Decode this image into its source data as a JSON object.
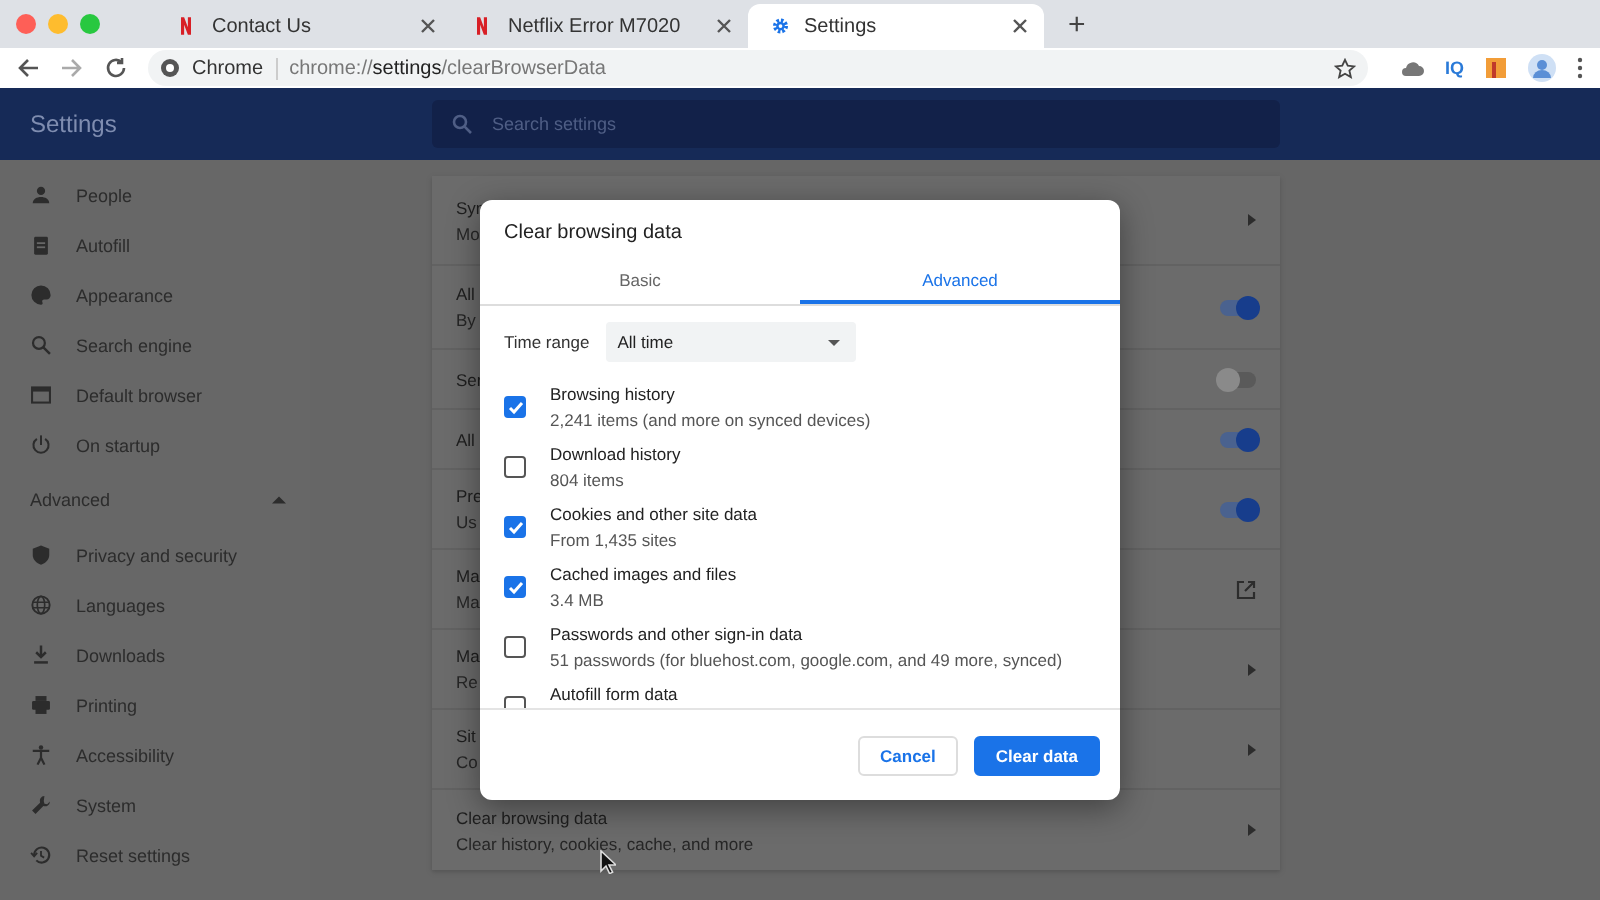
{
  "browser": {
    "tabs": [
      {
        "title": "Contact Us",
        "selected": false
      },
      {
        "title": "Netflix Error M7020",
        "selected": false
      },
      {
        "title": "Settings",
        "selected": true
      }
    ],
    "new_tab": "+",
    "address": {
      "site_label": "Chrome",
      "url": "chrome://**settings**/clearBrowserData"
    },
    "extension_label": "IQ"
  },
  "header": {
    "title": "Settings",
    "search": {
      "placeholder": "Search settings"
    }
  },
  "sidebar": {
    "items": [
      {
        "label": "People"
      },
      {
        "label": "Autofill"
      },
      {
        "label": "Appearance"
      },
      {
        "label": "Search engine"
      },
      {
        "label": "Default browser"
      },
      {
        "label": "On startup"
      }
    ],
    "advanced": {
      "label": "Advanced",
      "expanded": true,
      "items": [
        {
          "label": "Privacy and security"
        },
        {
          "label": "Languages"
        },
        {
          "label": "Downloads"
        },
        {
          "label": "Printing"
        },
        {
          "label": "Accessibility"
        },
        {
          "label": "System"
        },
        {
          "label": "Reset settings"
        }
      ]
    }
  },
  "content": {
    "rows": [
      {
        "title": "Syn",
        "subtitle": "Mo",
        "kind": "arrow"
      },
      {
        "title": "All",
        "subtitle": "By",
        "kind": "toggle",
        "on": true
      },
      {
        "title": "Ser",
        "kind": "toggle",
        "on": false
      },
      {
        "title": "All",
        "kind": "toggle",
        "on": true
      },
      {
        "title": "Pre",
        "subtitle": "Us",
        "kind": "toggle",
        "on": true
      },
      {
        "title": "Ma",
        "subtitle": "Ma",
        "kind": "external"
      },
      {
        "title": "Ma",
        "subtitle": "Re",
        "kind": "arrow"
      },
      {
        "title": "Sit",
        "subtitle": "Co",
        "kind": "arrow"
      },
      {
        "title": "Clear browsing data",
        "subtitle": "Clear history, cookies, cache, and more",
        "kind": "arrow"
      }
    ]
  },
  "dialog": {
    "title": "Clear browsing data",
    "tabs": [
      {
        "label": "Basic",
        "selected": false
      },
      {
        "label": "Advanced",
        "selected": true
      }
    ],
    "time_range": {
      "label": "Time range",
      "value": "All time"
    },
    "items": [
      {
        "label": "Browsing history",
        "detail": "2,241 items (and more on synced devices)",
        "checked": true
      },
      {
        "label": "Download history",
        "detail": "804 items",
        "checked": false
      },
      {
        "label": "Cookies and other site data",
        "detail": "From 1,435 sites",
        "checked": true
      },
      {
        "label": "Cached images and files",
        "detail": "3.4 MB",
        "checked": true
      },
      {
        "label": "Passwords and other sign-in data",
        "detail": "51 passwords (for bluehost.com, google.com, and 49 more, synced)",
        "checked": false
      },
      {
        "label": "Autofill form data",
        "checked": false
      }
    ],
    "buttons": [
      {
        "label": "Cancel",
        "kind": "secondary"
      },
      {
        "label": "Clear data",
        "kind": "primary"
      }
    ]
  }
}
